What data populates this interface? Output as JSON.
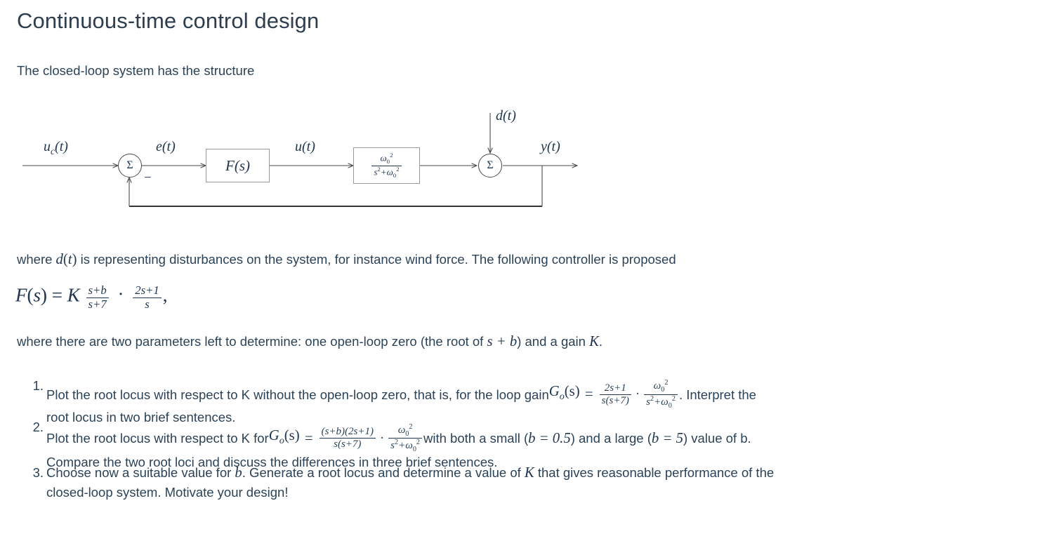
{
  "document": {
    "title": "Continuous-time control design",
    "intro": "The closed-loop system has the structure",
    "where_disturbance": "where d(t) is representing disturbances on the system, for instance wind force. The following controller is proposed",
    "where_disturbance_pre": "where ",
    "where_disturbance_post": " is representing disturbances on the system, for instance wind force. The following controller is proposed",
    "where_params_pre": "where there are two parameters left to determine: one open-loop zero (the root of ",
    "where_params_mid": ") and a gain ",
    "where_params_post": "."
  },
  "diagram": {
    "name": "closed-loop-block-diagram",
    "labels": {
      "reference": "u",
      "reference_sub": "c",
      "reference_arg": "(t)",
      "error": "e(t)",
      "control": "u(t)",
      "disturbance": "d(t)",
      "output": "y(t)",
      "sum_symbol": "Σ",
      "minus_sign": "−"
    },
    "controller_block": "F(s)",
    "plant_block": {
      "numerator": "ω₀²",
      "denominator": "s²+ω₀²",
      "num_base": "ω",
      "num_sub": "0",
      "num_sup": "2",
      "den": "s",
      "den_sup": "2",
      "den_tail": "+ω",
      "den_tail_sub": "0",
      "den_tail_sup": "2"
    }
  },
  "equation_fs": {
    "lhs": "F(s)",
    "equals": "=",
    "gain": "K",
    "frac1_num": "s+b",
    "frac1_den": "s+7",
    "dot": "·",
    "frac2_num": "2s+1",
    "frac2_den": "s",
    "comma": ","
  },
  "list": {
    "items": [
      {
        "marker": "1.",
        "line1_pre": "Plot the root locus with respect to K without the open-loop zero, that is, for the loop gain ",
        "go_label": "G",
        "go_sub": "o",
        "go_arg": "(s)",
        "equals": "=",
        "frac1_num": "2s+1",
        "frac1_den": "s(s+7)",
        "dot": "·",
        "frac2_num": "ω₀²",
        "frac2_den": "s²+ω₀²",
        "line1_post": ". Interpret the",
        "line2": "root locus in two brief sentences."
      },
      {
        "marker": "2.",
        "line1_pre": "Plot the root locus with respect to K for ",
        "go_label": "G",
        "go_sub": "o",
        "go_arg": "(s)",
        "equals": "=",
        "frac1_num": "(s+b)(2s+1)",
        "frac1_den": "s(s+7)",
        "dot": "·",
        "frac2_num": "ω₀²",
        "frac2_den": "s²+ω₀²",
        "line1_mid": " with both a small (",
        "b_small": "b = 0.5",
        "line1_mid2": ") and a large (",
        "b_large": "b = 5",
        "line1_post": ") value of b.",
        "line2": "Compare the two root loci and discuss the differences in three brief sentences."
      },
      {
        "marker": "3.",
        "line1_pre": "Choose now a suitable value for ",
        "b_symbol": "b",
        "line1_mid": ". Generate a root locus and determine a value of ",
        "k_symbol": "K",
        "line1_post": " that gives reasonable performance of the",
        "line2": "closed-loop system. Motivate your design!"
      }
    ]
  },
  "symbols": {
    "d_of_t": "d(t)",
    "s_plus_b": "s + b",
    "K": "K",
    "b": "b"
  },
  "colors": {
    "text": "#2b4257",
    "heading": "#2e3e4e",
    "math": "#1f3550",
    "line": "#4a4a4a",
    "box_border": "#9a9a9a",
    "background": "#ffffff"
  }
}
